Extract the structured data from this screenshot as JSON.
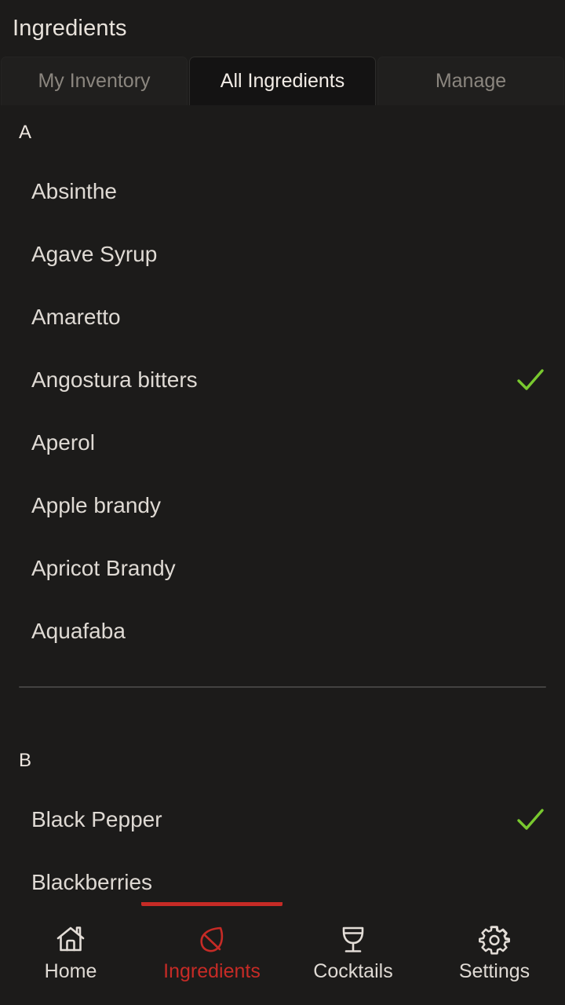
{
  "header": {
    "title": "Ingredients"
  },
  "tabs": [
    {
      "label": "My Inventory",
      "active": false
    },
    {
      "label": "All Ingredients",
      "active": true
    },
    {
      "label": "Manage",
      "active": false
    }
  ],
  "colors": {
    "background": "#1c1b1a",
    "accent_red": "#c62b26",
    "check_green": "#79c92f",
    "text_primary": "#dfdad4",
    "text_muted": "#8b867f",
    "divider": "#434241"
  },
  "sections": [
    {
      "letter": "A",
      "items": [
        {
          "name": "Absinthe",
          "in_inventory": false
        },
        {
          "name": "Agave Syrup",
          "in_inventory": false
        },
        {
          "name": "Amaretto",
          "in_inventory": false
        },
        {
          "name": "Angostura bitters",
          "in_inventory": true
        },
        {
          "name": "Aperol",
          "in_inventory": false
        },
        {
          "name": "Apple brandy",
          "in_inventory": false
        },
        {
          "name": "Apricot Brandy",
          "in_inventory": false
        },
        {
          "name": "Aquafaba",
          "in_inventory": false
        }
      ]
    },
    {
      "letter": "B",
      "items": [
        {
          "name": "Black Pepper",
          "in_inventory": true
        },
        {
          "name": "Blackberries",
          "in_inventory": false
        }
      ]
    }
  ],
  "bottom_nav": [
    {
      "label": "Home",
      "icon": "home-icon",
      "active": false
    },
    {
      "label": "Ingredients",
      "icon": "leaf-icon",
      "active": true
    },
    {
      "label": "Cocktails",
      "icon": "cocktail-glass-icon",
      "active": false
    },
    {
      "label": "Settings",
      "icon": "gear-icon",
      "active": false
    }
  ]
}
